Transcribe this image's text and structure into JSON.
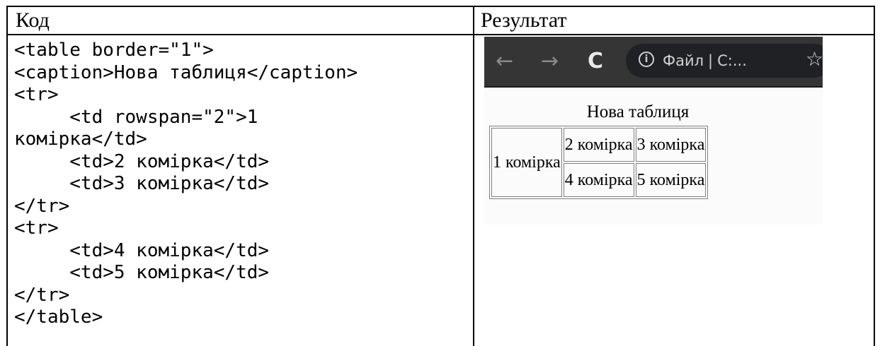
{
  "headers": {
    "code": "Код",
    "result": "Результат"
  },
  "code_lines": [
    "<table border=\"1\">",
    "<caption>Нова таблиця</caption>",
    "<tr>",
    "     <td rowspan=\"2\">1",
    "комірка</td>",
    "     <td>2 комірка</td>",
    "     <td>3 комірка</td>",
    "</tr>",
    "<tr>",
    "     <td>4 комірка</td>",
    "     <td>5 комірка</td>",
    "</tr>",
    "</table>"
  ],
  "browser": {
    "icons": [
      "back-arrow-icon",
      "forward-arrow-icon",
      "reload-icon",
      "info-icon",
      "star-icon"
    ],
    "address_label": "Файл",
    "address_text": "C:...",
    "bar_color": "#353535"
  },
  "demo": {
    "caption": "Нова таблиця",
    "cells": {
      "c1": "1 комірка",
      "c2": "2 комірка",
      "c3": "3 комірка",
      "c4": "4 комірка",
      "c5": "5 комірка"
    }
  }
}
